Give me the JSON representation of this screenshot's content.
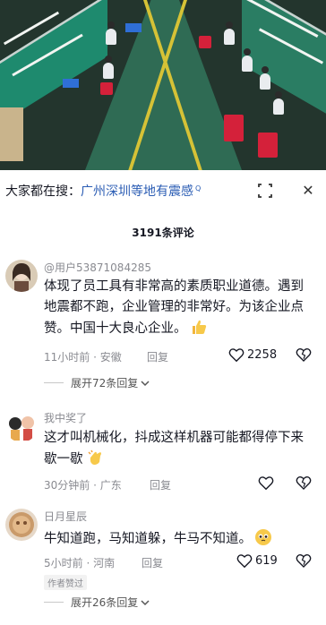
{
  "video": {
    "description_icon": "factory-video-frame"
  },
  "search": {
    "prefix": "大家都在搜：",
    "term": "广州深圳等地有震感",
    "mark": "Q",
    "expand_icon": "expand-icon",
    "close_icon": "close-icon",
    "close_symbol": "✕"
  },
  "comments_header": {
    "count_label": "3191条评论"
  },
  "comments": [
    {
      "username": "@用户53871084285",
      "text": "体现了员工具有非常高的素质职业道德。遇到地震都不跑，企业管理的非常好。为该企业点赞。中国十大良心企业。",
      "emoji": "thumbs-up-emoji",
      "time_location": "11小时前 · 安徽",
      "reply_label": "回复",
      "likes": "2258",
      "expand_label": "展开72条回复"
    },
    {
      "username": "我中奖了",
      "text": "这才叫机械化，抖成这样机器可能都得停下来歇一歇",
      "emoji": "clapping-hand-emoji",
      "time_location": "30分钟前 · 广东",
      "reply_label": "回复",
      "likes": ""
    },
    {
      "username": "日月星辰",
      "text": "牛知道跑，马知道躲，牛马不知道。",
      "emoji": "pleading-face-emoji",
      "time_location": "5小时前 · 河南",
      "reply_label": "回复",
      "likes": "619",
      "author_badge": "作者赞过",
      "expand_label": "展开26条回复"
    }
  ],
  "colors": {
    "accent_link": "#2b5db4",
    "muted": "#8a8b91",
    "text": "#161823"
  }
}
